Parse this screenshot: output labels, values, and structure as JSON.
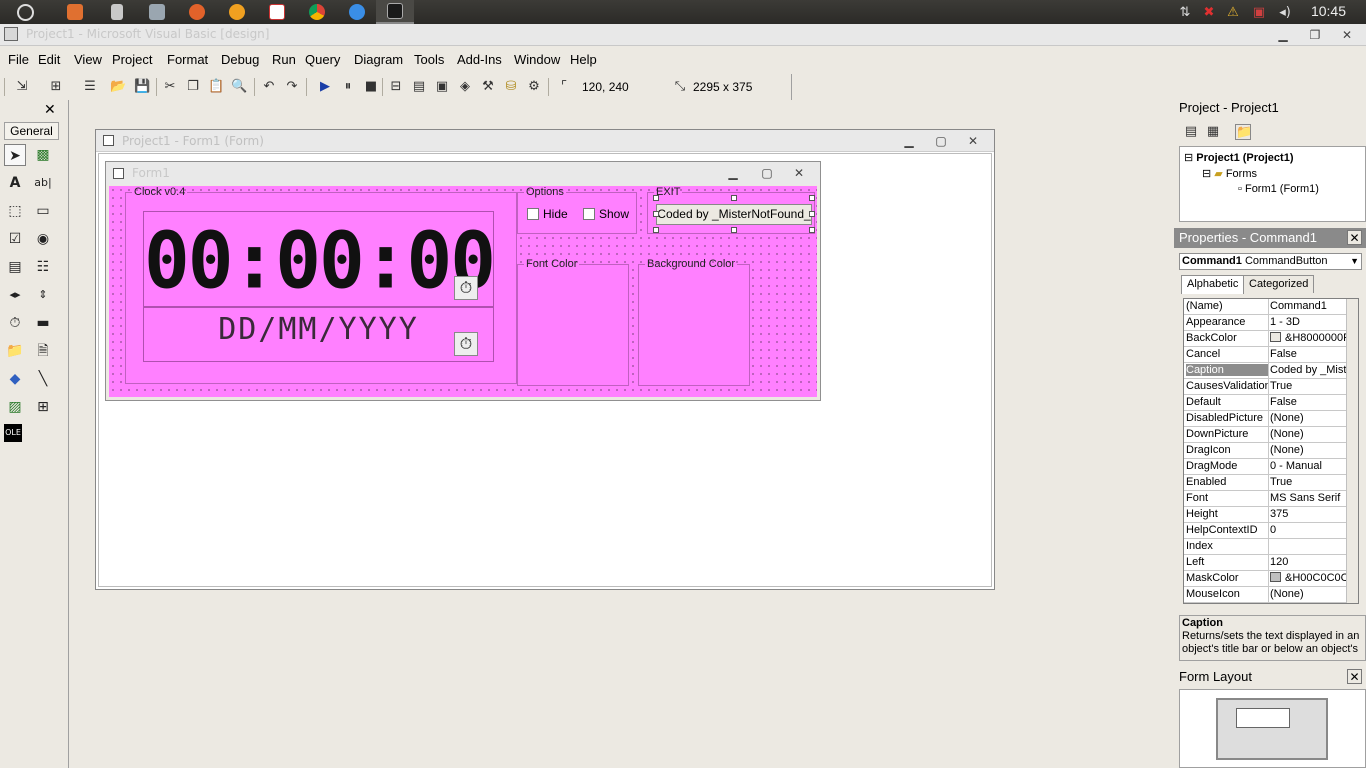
{
  "clock": "10:45",
  "window_title": "Project1 - Microsoft Visual Basic [design]",
  "menu": [
    "File",
    "Edit",
    "View",
    "Project",
    "Format",
    "Debug",
    "Run",
    "Query",
    "Diagram",
    "Tools",
    "Add-Ins",
    "Window",
    "Help"
  ],
  "toolbar": {
    "position": "120, 240",
    "size": "2295 x 375"
  },
  "toolbox": {
    "tab_label": "General"
  },
  "designer": {
    "title": "Project1 - Form1 (Form)"
  },
  "form1": {
    "title": "Form1",
    "clock_frame": "Clock v0.4",
    "time": "00:00:00",
    "date": "DD/MM/YYYY",
    "options_frame": "Options",
    "hide_label": "Hide",
    "show_label": "Show",
    "exit_frame": "EXIT",
    "command_caption": "Coded by _MisterNotFound_",
    "font_color_frame": "Font Color",
    "bg_color_frame": "Background Color",
    "back_color_hex": "#ff80ff"
  },
  "project_pane": {
    "title": "Project - Project1",
    "tree": {
      "root": "Project1 (Project1)",
      "folder": "Forms",
      "item": "Form1 (Form1)"
    }
  },
  "properties_pane": {
    "title": "Properties - Command1",
    "object_name": "Command1",
    "object_type": "CommandButton",
    "tab_alphabetic": "Alphabetic",
    "tab_categorized": "Categorized",
    "rows": [
      {
        "name": "(Name)",
        "value": "Command1"
      },
      {
        "name": "Appearance",
        "value": "1 - 3D"
      },
      {
        "name": "BackColor",
        "value": "&H8000000F"
      },
      {
        "name": "Cancel",
        "value": "False"
      },
      {
        "name": "Caption",
        "value": "Coded by _Mist"
      },
      {
        "name": "CausesValidation",
        "value": "True"
      },
      {
        "name": "Default",
        "value": "False"
      },
      {
        "name": "DisabledPicture",
        "value": "(None)"
      },
      {
        "name": "DownPicture",
        "value": "(None)"
      },
      {
        "name": "DragIcon",
        "value": "(None)"
      },
      {
        "name": "DragMode",
        "value": "0 - Manual"
      },
      {
        "name": "Enabled",
        "value": "True"
      },
      {
        "name": "Font",
        "value": "MS Sans Serif"
      },
      {
        "name": "Height",
        "value": "375"
      },
      {
        "name": "HelpContextID",
        "value": "0"
      },
      {
        "name": "Index",
        "value": ""
      },
      {
        "name": "Left",
        "value": "120"
      },
      {
        "name": "MaskColor",
        "value": "&H00C0C0C"
      },
      {
        "name": "MouseIcon",
        "value": "(None)"
      }
    ],
    "desc_title": "Caption",
    "desc_text": "Returns/sets the text displayed in an object's title bar or below an object's"
  },
  "form_layout": {
    "title": "Form Layout"
  }
}
